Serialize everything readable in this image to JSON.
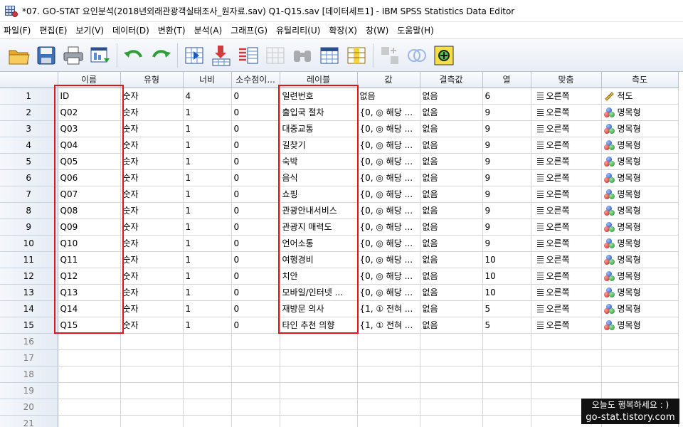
{
  "window": {
    "title": "*07. GO-STAT 요인분석(2018년외래관광객실태조사_원자료.sav) Q1-Q15.sav [데이터세트1] - IBM SPSS Statistics Data Editor"
  },
  "menu": {
    "items": [
      "파일(F)",
      "편집(E)",
      "보기(V)",
      "데이터(D)",
      "변환(T)",
      "분석(A)",
      "그래프(G)",
      "유틸리티(U)",
      "확장(X)",
      "창(W)",
      "도움말(H)"
    ]
  },
  "toolbar": {
    "icons": [
      "open-folder-icon",
      "save-icon",
      "print-icon",
      "recall-dialog-icon",
      "undo-icon",
      "redo-icon",
      "goto-case-icon",
      "goto-variable-icon",
      "variables-icon",
      "run-descriptives-icon",
      "find-icon",
      "insert-cases-icon",
      "insert-variable-icon",
      "split-file-icon",
      "weight-cases-icon",
      "select-cases-icon",
      "value-labels-icon",
      "use-variable-sets-icon",
      "spelling-icon"
    ]
  },
  "grid": {
    "columns": [
      "이름",
      "유형",
      "너비",
      "소수점이...",
      "레이블",
      "값",
      "결측값",
      "열",
      "맞춤",
      "측도"
    ],
    "rows": [
      {
        "n": "1",
        "name": "ID",
        "type": "숫자",
        "width": "4",
        "dec": "0",
        "label": "일련번호",
        "values": "없음",
        "missing": "없음",
        "cols": "6",
        "align": "오른쪽",
        "measure": "척도",
        "measure_kind": "scale"
      },
      {
        "n": "2",
        "name": "Q02",
        "type": "숫자",
        "width": "1",
        "dec": "0",
        "label": "출입국 절차",
        "values": "{0, ◎ 해당 ...",
        "missing": "없음",
        "cols": "9",
        "align": "오른쪽",
        "measure": "명목형",
        "measure_kind": "nominal"
      },
      {
        "n": "3",
        "name": "Q03",
        "type": "숫자",
        "width": "1",
        "dec": "0",
        "label": "대중교통",
        "values": "{0, ◎ 해당 ...",
        "missing": "없음",
        "cols": "9",
        "align": "오른쪽",
        "measure": "명목형",
        "measure_kind": "nominal"
      },
      {
        "n": "4",
        "name": "Q04",
        "type": "숫자",
        "width": "1",
        "dec": "0",
        "label": "길찾기",
        "values": "{0, ◎ 해당 ...",
        "missing": "없음",
        "cols": "9",
        "align": "오른쪽",
        "measure": "명목형",
        "measure_kind": "nominal"
      },
      {
        "n": "5",
        "name": "Q05",
        "type": "숫자",
        "width": "1",
        "dec": "0",
        "label": "숙박",
        "values": "{0, ◎ 해당 ...",
        "missing": "없음",
        "cols": "9",
        "align": "오른쪽",
        "measure": "명목형",
        "measure_kind": "nominal"
      },
      {
        "n": "6",
        "name": "Q06",
        "type": "숫자",
        "width": "1",
        "dec": "0",
        "label": "음식",
        "values": "{0, ◎ 해당 ...",
        "missing": "없음",
        "cols": "9",
        "align": "오른쪽",
        "measure": "명목형",
        "measure_kind": "nominal"
      },
      {
        "n": "7",
        "name": "Q07",
        "type": "숫자",
        "width": "1",
        "dec": "0",
        "label": "쇼핑",
        "values": "{0, ◎ 해당 ...",
        "missing": "없음",
        "cols": "9",
        "align": "오른쪽",
        "measure": "명목형",
        "measure_kind": "nominal"
      },
      {
        "n": "8",
        "name": "Q08",
        "type": "숫자",
        "width": "1",
        "dec": "0",
        "label": "관광안내서비스",
        "values": "{0, ◎ 해당 ...",
        "missing": "없음",
        "cols": "9",
        "align": "오른쪽",
        "measure": "명목형",
        "measure_kind": "nominal"
      },
      {
        "n": "9",
        "name": "Q09",
        "type": "숫자",
        "width": "1",
        "dec": "0",
        "label": "관광지 매력도",
        "values": "{0, ◎ 해당 ...",
        "missing": "없음",
        "cols": "9",
        "align": "오른쪽",
        "measure": "명목형",
        "measure_kind": "nominal"
      },
      {
        "n": "10",
        "name": "Q10",
        "type": "숫자",
        "width": "1",
        "dec": "0",
        "label": "언어소통",
        "values": "{0, ◎ 해당 ...",
        "missing": "없음",
        "cols": "9",
        "align": "오른쪽",
        "measure": "명목형",
        "measure_kind": "nominal"
      },
      {
        "n": "11",
        "name": "Q11",
        "type": "숫자",
        "width": "1",
        "dec": "0",
        "label": "여행경비",
        "values": "{0, ◎ 해당 ...",
        "missing": "없음",
        "cols": "10",
        "align": "오른쪽",
        "measure": "명목형",
        "measure_kind": "nominal"
      },
      {
        "n": "12",
        "name": "Q12",
        "type": "숫자",
        "width": "1",
        "dec": "0",
        "label": "치안",
        "values": "{0, ◎ 해당 ...",
        "missing": "없음",
        "cols": "10",
        "align": "오른쪽",
        "measure": "명목형",
        "measure_kind": "nominal"
      },
      {
        "n": "13",
        "name": "Q13",
        "type": "숫자",
        "width": "1",
        "dec": "0",
        "label": "모바일/인터넷 ...",
        "values": "{0, ◎ 해당 ...",
        "missing": "없음",
        "cols": "10",
        "align": "오른쪽",
        "measure": "명목형",
        "measure_kind": "nominal"
      },
      {
        "n": "14",
        "name": "Q14",
        "type": "숫자",
        "width": "1",
        "dec": "0",
        "label": "재방문 의사",
        "values": "{1, ① 전혀 ...",
        "missing": "없음",
        "cols": "5",
        "align": "오른쪽",
        "measure": "명목형",
        "measure_kind": "nominal"
      },
      {
        "n": "15",
        "name": "Q15",
        "type": "숫자",
        "width": "1",
        "dec": "0",
        "label": "타인 추천 의향",
        "values": "{1, ① 전혀 ...",
        "missing": "없음",
        "cols": "5",
        "align": "오른쪽",
        "measure": "명목형",
        "measure_kind": "nominal"
      }
    ],
    "empty_rows": [
      "16",
      "17",
      "18",
      "19",
      "20",
      "21"
    ]
  },
  "watermark": {
    "line1": "오늘도 행복하세요 : )",
    "line2": "go-stat.tistory.com"
  },
  "colors": {
    "highlight": "#e31414",
    "header_bg": "#e9eef6"
  }
}
